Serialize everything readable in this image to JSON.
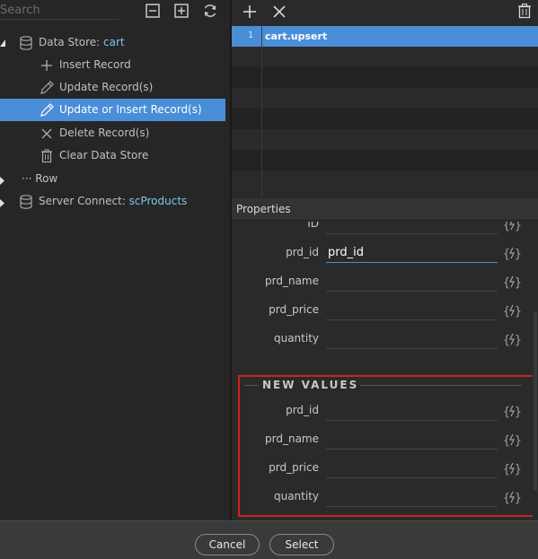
{
  "left_toolbar": {
    "search_placeholder": "Search",
    "icons": [
      "collapse-all-icon",
      "expand-all-icon",
      "refresh-icon"
    ]
  },
  "tree": [
    {
      "prefix": "Data Store: ",
      "accent": "cart",
      "icon": "database-icon",
      "expanded": true
    },
    {
      "label": "Insert Record",
      "icon": "plus-icon"
    },
    {
      "label": "Update Record(s)",
      "icon": "pencil-icon"
    },
    {
      "label": "Update or Insert Record(s)",
      "icon": "pencil-icon",
      "selected": true
    },
    {
      "label": "Delete Record(s)",
      "icon": "x-icon"
    },
    {
      "label": "Clear Data Store",
      "icon": "trash-icon"
    },
    {
      "prefix": "··· ",
      "label": "Row",
      "icon": "ellipsis-icon",
      "collapsed": true
    },
    {
      "prefix": "Server Connect: ",
      "accent": "scProducts",
      "icon": "database-icon",
      "collapsed": true
    }
  ],
  "right_toolbar": {
    "icons": [
      "add-icon",
      "remove-icon",
      "delete-icon"
    ]
  },
  "steps": [
    {
      "num": "1",
      "text": "cart.upsert"
    }
  ],
  "properties": {
    "header": "Properties",
    "fields": [
      {
        "label": "ID",
        "value": ""
      },
      {
        "label": "prd_id",
        "value": "prd_id"
      },
      {
        "label": "prd_name",
        "value": ""
      },
      {
        "label": "prd_price",
        "value": ""
      },
      {
        "label": "quantity",
        "value": ""
      }
    ],
    "new_values_title": "NEW VALUES",
    "new_values": [
      {
        "label": "prd_id",
        "value": ""
      },
      {
        "label": "prd_name",
        "value": ""
      },
      {
        "label": "prd_price",
        "value": ""
      },
      {
        "label": "quantity",
        "value": ""
      }
    ]
  },
  "footer": {
    "cancel_label": "Cancel",
    "select_label": "Select"
  },
  "colors": {
    "accent": "#4a8ed8",
    "link": "#7fc6ef",
    "highlight_box": "#d42020"
  }
}
